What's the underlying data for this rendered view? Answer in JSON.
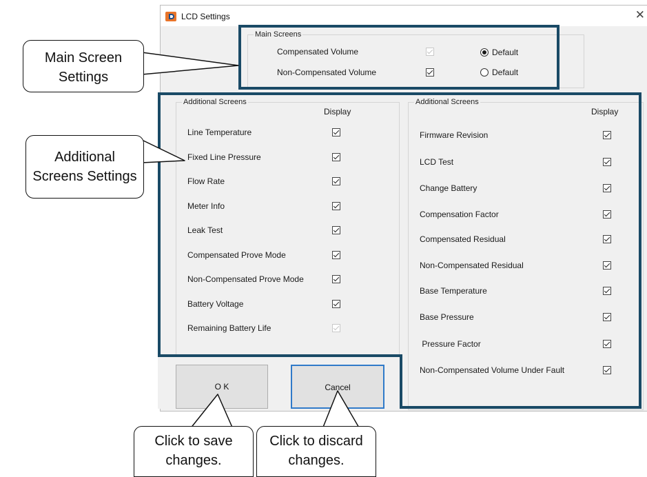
{
  "window": {
    "title": "LCD Settings",
    "close_glyph": "✕",
    "icon": "app-logo-icon"
  },
  "main_screens": {
    "legend": "Main Screens",
    "rows": [
      {
        "label": "Compensated Volume",
        "checked": true,
        "disabled": true,
        "radio_label": "Default",
        "radio_selected": true
      },
      {
        "label": "Non-Compensated Volume",
        "checked": true,
        "disabled": false,
        "radio_label": "Default",
        "radio_selected": false
      }
    ]
  },
  "left_panel": {
    "legend": "Additional Screens",
    "header": "Display",
    "items": [
      {
        "label": "Line Temperature",
        "checked": true,
        "disabled": false
      },
      {
        "label": "Fixed Line Pressure",
        "checked": true,
        "disabled": false
      },
      {
        "label": "Flow Rate",
        "checked": true,
        "disabled": false
      },
      {
        "label": "Meter Info",
        "checked": true,
        "disabled": false
      },
      {
        "label": "Leak Test",
        "checked": true,
        "disabled": false
      },
      {
        "label": "Compensated Prove Mode",
        "checked": true,
        "disabled": false
      },
      {
        "label": "Non-Compensated Prove Mode",
        "checked": true,
        "disabled": false
      },
      {
        "label": "Battery Voltage",
        "checked": true,
        "disabled": false
      },
      {
        "label": "Remaining Battery Life",
        "checked": true,
        "disabled": true
      }
    ]
  },
  "right_panel": {
    "legend": "Additional Screens",
    "header": "Display",
    "items": [
      {
        "label": "Firmware Revision",
        "checked": true
      },
      {
        "label": "LCD Test",
        "checked": true
      },
      {
        "label": "Change Battery",
        "checked": true
      },
      {
        "label": "Compensation Factor",
        "checked": true
      },
      {
        "label": "Compensated Residual",
        "checked": true
      },
      {
        "label": "Non-Compensated Residual",
        "checked": true
      },
      {
        "label": "Base Temperature",
        "checked": true
      },
      {
        "label": "Base Pressure",
        "checked": true
      },
      {
        "label": " Pressure Factor",
        "checked": true
      },
      {
        "label": "Non-Compensated Volume Under Fault",
        "checked": true
      }
    ]
  },
  "buttons": {
    "ok": "O K",
    "cancel": "Cancel"
  },
  "callouts": {
    "main_screen": [
      "Main Screen",
      "Settings"
    ],
    "additional": [
      "Additional",
      "Screens Settings"
    ],
    "save": [
      "Click to save",
      "changes."
    ],
    "discard": [
      "Click to discard",
      "changes."
    ]
  },
  "colors": {
    "highlight_frame": "#1a4a66",
    "dialog_bg": "#f0f0f0",
    "focus_border": "#2f7ac9"
  }
}
